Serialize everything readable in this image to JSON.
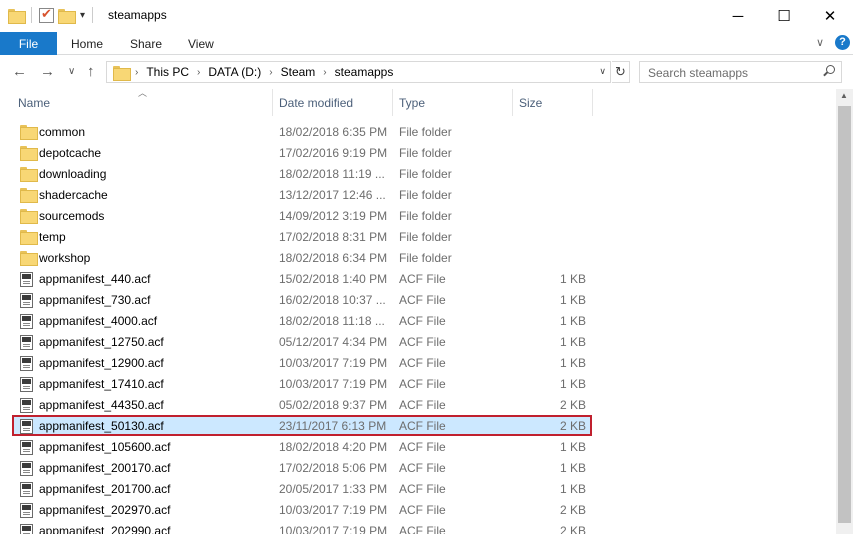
{
  "window": {
    "title": "steamapps",
    "minimize_glyph": "─",
    "maximize_glyph": "☐",
    "close_glyph": "✕",
    "qat_dropdown_glyph": "▾"
  },
  "ribbon": {
    "tabs": [
      "File",
      "Home",
      "Share",
      "View"
    ],
    "collapse_glyph": "∨",
    "help_glyph": "?"
  },
  "nav": {
    "back_glyph": "←",
    "forward_glyph": "→",
    "recent_glyph": "∨",
    "up_glyph": "↑",
    "breadcrumb": [
      "This PC",
      "DATA (D:)",
      "Steam",
      "steamapps"
    ],
    "breadcrumb_sep_glyph": "›",
    "dropdown_glyph": "∨",
    "refresh_glyph": "↻"
  },
  "search": {
    "placeholder": "Search steamapps"
  },
  "columns": {
    "name": "Name",
    "date": "Date modified",
    "type": "Type",
    "size": "Size"
  },
  "files": [
    {
      "name": "common",
      "date": "18/02/2018 6:35 PM",
      "type": "File folder",
      "size": "",
      "icon": "folder-icon"
    },
    {
      "name": "depotcache",
      "date": "17/02/2016 9:19 PM",
      "type": "File folder",
      "size": "",
      "icon": "folder-icon"
    },
    {
      "name": "downloading",
      "date": "18/02/2018 11:19 ...",
      "type": "File folder",
      "size": "",
      "icon": "folder-icon"
    },
    {
      "name": "shadercache",
      "date": "13/12/2017 12:46 ...",
      "type": "File folder",
      "size": "",
      "icon": "folder-icon"
    },
    {
      "name": "sourcemods",
      "date": "14/09/2012 3:19 PM",
      "type": "File folder",
      "size": "",
      "icon": "folder-icon"
    },
    {
      "name": "temp",
      "date": "17/02/2018 8:31 PM",
      "type": "File folder",
      "size": "",
      "icon": "folder-icon"
    },
    {
      "name": "workshop",
      "date": "18/02/2018 6:34 PM",
      "type": "File folder",
      "size": "",
      "icon": "folder-icon"
    },
    {
      "name": "appmanifest_440.acf",
      "date": "15/02/2018 1:40 PM",
      "type": "ACF File",
      "size": "1 KB",
      "icon": "file-icon"
    },
    {
      "name": "appmanifest_730.acf",
      "date": "16/02/2018 10:37 ...",
      "type": "ACF File",
      "size": "1 KB",
      "icon": "file-icon"
    },
    {
      "name": "appmanifest_4000.acf",
      "date": "18/02/2018 11:18 ...",
      "type": "ACF File",
      "size": "1 KB",
      "icon": "file-icon"
    },
    {
      "name": "appmanifest_12750.acf",
      "date": "05/12/2017 4:34 PM",
      "type": "ACF File",
      "size": "1 KB",
      "icon": "file-icon"
    },
    {
      "name": "appmanifest_12900.acf",
      "date": "10/03/2017 7:19 PM",
      "type": "ACF File",
      "size": "1 KB",
      "icon": "file-icon"
    },
    {
      "name": "appmanifest_17410.acf",
      "date": "10/03/2017 7:19 PM",
      "type": "ACF File",
      "size": "1 KB",
      "icon": "file-icon"
    },
    {
      "name": "appmanifest_44350.acf",
      "date": "05/02/2018 9:37 PM",
      "type": "ACF File",
      "size": "2 KB",
      "icon": "file-icon"
    },
    {
      "name": "appmanifest_50130.acf",
      "date": "23/11/2017 6:13 PM",
      "type": "ACF File",
      "size": "2 KB",
      "icon": "file-icon",
      "selected": true
    },
    {
      "name": "appmanifest_105600.acf",
      "date": "18/02/2018 4:20 PM",
      "type": "ACF File",
      "size": "1 KB",
      "icon": "file-icon"
    },
    {
      "name": "appmanifest_200170.acf",
      "date": "17/02/2018 5:06 PM",
      "type": "ACF File",
      "size": "1 KB",
      "icon": "file-icon"
    },
    {
      "name": "appmanifest_201700.acf",
      "date": "20/05/2017 1:33 PM",
      "type": "ACF File",
      "size": "1 KB",
      "icon": "file-icon"
    },
    {
      "name": "appmanifest_202970.acf",
      "date": "10/03/2017 7:19 PM",
      "type": "ACF File",
      "size": "2 KB",
      "icon": "file-icon"
    },
    {
      "name": "appmanifest_202990.acf",
      "date": "10/03/2017 7:19 PM",
      "type": "ACF File",
      "size": "2 KB",
      "icon": "file-icon"
    }
  ],
  "colors": {
    "accent": "#1979ca",
    "selection_bg": "#cce8ff",
    "highlight_border": "#c0202e",
    "folder": "#f8d775"
  }
}
